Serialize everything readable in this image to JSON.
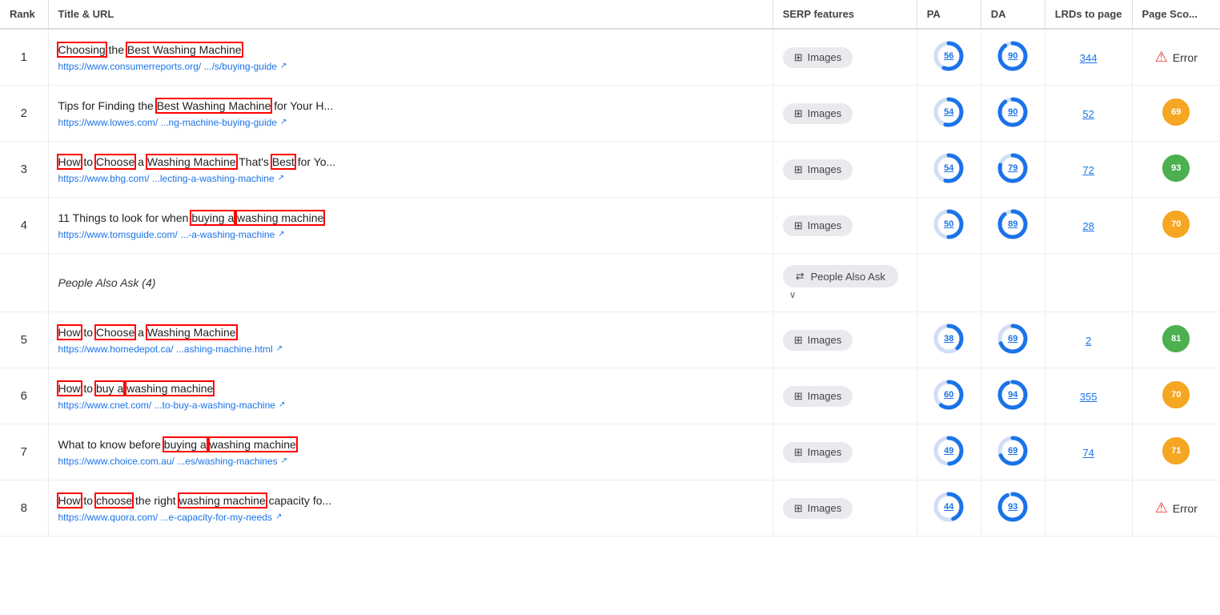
{
  "header": {
    "rank": "Rank",
    "title_url": "Title & URL",
    "serp_features": "SERP features",
    "pa": "PA",
    "da": "DA",
    "lrds": "LRDs to page",
    "page_score": "Page Sco..."
  },
  "rows": [
    {
      "rank": "1",
      "title_parts": [
        {
          "text": "Choosing",
          "highlight": true
        },
        {
          "text": " the "
        },
        {
          "text": "Best Washing Machine",
          "highlight": true
        }
      ],
      "title_full": "Choosing the Best Washing Machine",
      "url_display": "https://www.consumerreports.org/ .../s/buying-guide",
      "serp": "Images",
      "pa": 56,
      "pa_color": "#1a73e8",
      "pa_bg": "#d0dff7",
      "da": 90,
      "da_color": "#1a73e8",
      "da_bg": "#d0dff7",
      "lrds": "344",
      "score": null,
      "score_val": null,
      "error": true,
      "is_paa": false
    },
    {
      "rank": "2",
      "title_parts": [
        {
          "text": "Tips for Finding the "
        },
        {
          "text": "Best Washing Machine",
          "highlight": true
        },
        {
          "text": " for Your H..."
        }
      ],
      "title_full": "Tips for Finding the Best Washing Machine for Your H...",
      "url_display": "https://www.lowes.com/ ...ng-machine-buying-guide",
      "serp": "Images",
      "pa": 54,
      "pa_color": "#1a73e8",
      "pa_bg": "#d0dff7",
      "da": 90,
      "da_color": "#1a73e8",
      "da_bg": "#d0dff7",
      "lrds": "52",
      "score": 69,
      "score_color": "#f5a623",
      "error": false,
      "is_paa": false
    },
    {
      "rank": "3",
      "title_parts": [
        {
          "text": "How",
          "highlight": true
        },
        {
          "text": " to "
        },
        {
          "text": "Choose",
          "highlight": true
        },
        {
          "text": " a "
        },
        {
          "text": "Washing Machine",
          "highlight": true
        },
        {
          "text": " That's "
        },
        {
          "text": "Best",
          "highlight": true
        },
        {
          "text": " for Yo..."
        }
      ],
      "title_full": "How to Choose a Washing Machine That's Best for Yo...",
      "url_display": "https://www.bhg.com/ ...lecting-a-washing-machine",
      "serp": "Images",
      "pa": 54,
      "pa_color": "#1a73e8",
      "pa_bg": "#d0dff7",
      "da": 79,
      "da_color": "#1a73e8",
      "da_bg": "#d0dff7",
      "lrds": "72",
      "score": 93,
      "score_color": "#4caf50",
      "error": false,
      "is_paa": false
    },
    {
      "rank": "4",
      "title_parts": [
        {
          "text": "11 Things to look for when "
        },
        {
          "text": "buying a",
          "highlight": true
        },
        {
          "text": " "
        },
        {
          "text": "washing machine",
          "highlight": true
        }
      ],
      "title_full": "11 Things to look for when buying a washing machine",
      "url_display": "https://www.tomsguide.com/ ...-a-washing-machine",
      "serp": "Images",
      "pa": 50,
      "pa_color": "#1a73e8",
      "pa_bg": "#d0dff7",
      "da": 89,
      "da_color": "#1a73e8",
      "da_bg": "#d0dff7",
      "lrds": "28",
      "score": 70,
      "score_color": "#f5a623",
      "error": false,
      "is_paa": false
    },
    {
      "rank": null,
      "is_paa": true,
      "paa_label": "People Also Ask (4)",
      "paa_badge": "People Also Ask"
    },
    {
      "rank": "5",
      "title_parts": [
        {
          "text": "How",
          "highlight": true
        },
        {
          "text": " to "
        },
        {
          "text": "Choose",
          "highlight": true
        },
        {
          "text": " a "
        },
        {
          "text": "Washing Machine",
          "highlight": true
        }
      ],
      "title_full": "How to Choose a Washing Machine",
      "url_display": "https://www.homedepot.ca/ ...ashing-machine.html",
      "serp": "Images",
      "pa": 38,
      "pa_color": "#1a73e8",
      "pa_bg": "#d0dff7",
      "da": 69,
      "da_color": "#1a73e8",
      "da_bg": "#d0dff7",
      "lrds": "2",
      "score": 81,
      "score_color": "#4caf50",
      "error": false,
      "is_paa": false
    },
    {
      "rank": "6",
      "title_parts": [
        {
          "text": "How",
          "highlight": true
        },
        {
          "text": " to "
        },
        {
          "text": "buy a",
          "highlight": true
        },
        {
          "text": " "
        },
        {
          "text": "washing machine",
          "highlight": true
        }
      ],
      "title_full": "How to buy a washing machine",
      "url_display": "https://www.cnet.com/ ...to-buy-a-washing-machine",
      "serp": "Images",
      "pa": 60,
      "pa_color": "#1a73e8",
      "pa_bg": "#d0dff7",
      "da": 94,
      "da_color": "#1a73e8",
      "da_bg": "#d0dff7",
      "lrds": "355",
      "score": 70,
      "score_color": "#f5a623",
      "error": false,
      "is_paa": false
    },
    {
      "rank": "7",
      "title_parts": [
        {
          "text": "What to know before "
        },
        {
          "text": "buying a",
          "highlight": true
        },
        {
          "text": " "
        },
        {
          "text": "washing machine",
          "highlight": true
        }
      ],
      "title_full": "What to know before buying a washing machine",
      "url_display": "https://www.choice.com.au/ ...es/washing-machines",
      "serp": "Images",
      "pa": 49,
      "pa_color": "#1a73e8",
      "pa_bg": "#d0dff7",
      "da": 69,
      "da_color": "#1a73e8",
      "da_bg": "#d0dff7",
      "lrds": "74",
      "score": 71,
      "score_color": "#f5a623",
      "error": false,
      "is_paa": false
    },
    {
      "rank": "8",
      "title_parts": [
        {
          "text": "How",
          "highlight": true
        },
        {
          "text": " to "
        },
        {
          "text": "choose",
          "highlight": true
        },
        {
          "text": " the right "
        },
        {
          "text": "washing machine",
          "highlight": true
        },
        {
          "text": " capacity fo..."
        }
      ],
      "title_full": "How to choose the right washing machine capacity fo...",
      "url_display": "https://www.quora.com/ ...e-capacity-for-my-needs",
      "serp": "Images",
      "pa": 44,
      "pa_color": "#1a73e8",
      "pa_bg": "#d0dff7",
      "da": 93,
      "da_color": "#1a73e8",
      "da_bg": "#d0dff7",
      "lrds": null,
      "score": null,
      "error": true,
      "is_paa": false
    }
  ]
}
